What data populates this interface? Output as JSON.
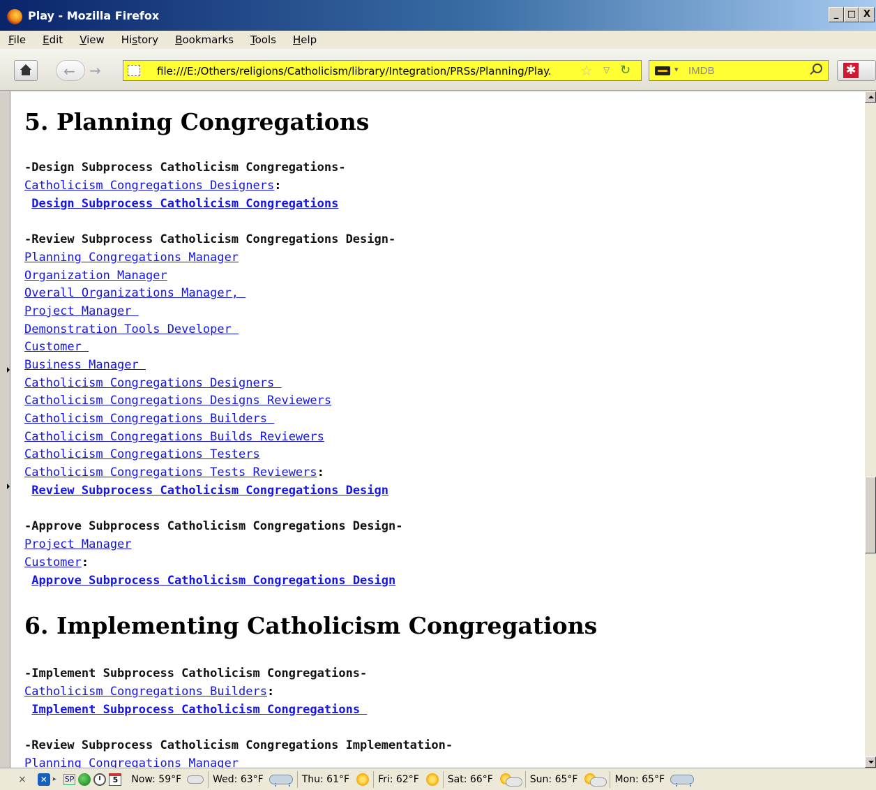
{
  "window": {
    "title": "Play - Mozilla Firefox",
    "controls": [
      "_",
      "□",
      "X"
    ]
  },
  "menu": [
    "File",
    "Edit",
    "View",
    "History",
    "Bookmarks",
    "Tools",
    "Help"
  ],
  "menu_access": [
    "F",
    "E",
    "V",
    "s",
    "B",
    "T",
    "H"
  ],
  "nav": {
    "url": "file:///E:/Others/religions/Catholicism/library/Integration/PRSs/Planning/Play.",
    "search_placeholder": "IMDB"
  },
  "doc": {
    "section5_title": "5. Planning Congregations",
    "design_header": "-Design Subprocess Catholicism Congregations-",
    "design_role": "Catholicism Congregations Designers",
    "design_task": "Design Subprocess Catholicism Congregations",
    "review_header": "-Review Subprocess Catholicism Congregations Design-",
    "review_roles": [
      "Planning Congregations Manager",
      "Organization Manager",
      "Overall Organizations Manager, ",
      "Project Manager ",
      "Demonstration Tools Developer ",
      "Customer ",
      "Business Manager ",
      "Catholicism Congregations Designers ",
      "Catholicism Congregations Designs Reviewers",
      "Catholicism Congregations Builders ",
      "Catholicism Congregations Builds Reviewers",
      "Catholicism Congregations Testers",
      "Catholicism Congregations Tests Reviewers"
    ],
    "review_task": "Review Subprocess Catholicism Congregations Design",
    "approve_header": "-Approve Subprocess Catholicism Congregations Design-",
    "approve_roles": [
      "Project Manager",
      "Customer"
    ],
    "approve_task": "Approve Subprocess Catholicism Congregations Design",
    "section6_title": "6. Implementing Catholicism Congregations",
    "implement_header": "-Implement Subprocess Catholicism Congregations-",
    "implement_role": "Catholicism Congregations Builders",
    "implement_task": "Implement Subprocess Catholicism Congregations ",
    "review_impl_header": "-Review Subprocess Catholicism Congregations Implementation-",
    "review_impl_role_partial": "Planning Congregations Manager",
    "colon": ":"
  },
  "status": {
    "close": "×",
    "sp_label": "SP",
    "calendar_day": "5",
    "weather": [
      {
        "label": "Now: 59°F",
        "icon": "cloud-icon"
      },
      {
        "label": "Wed: 63°F",
        "icon": "raincloud-icon"
      },
      {
        "label": "Thu: 61°F",
        "icon": "sun-icon"
      },
      {
        "label": "Fri: 62°F",
        "icon": "sun-icon"
      },
      {
        "label": "Sat: 66°F",
        "icon": "suncloud-icon"
      },
      {
        "label": "Sun: 65°F",
        "icon": "suncloud-icon"
      },
      {
        "label": "Mon: 65°F",
        "icon": "raincloud-icon"
      }
    ]
  }
}
